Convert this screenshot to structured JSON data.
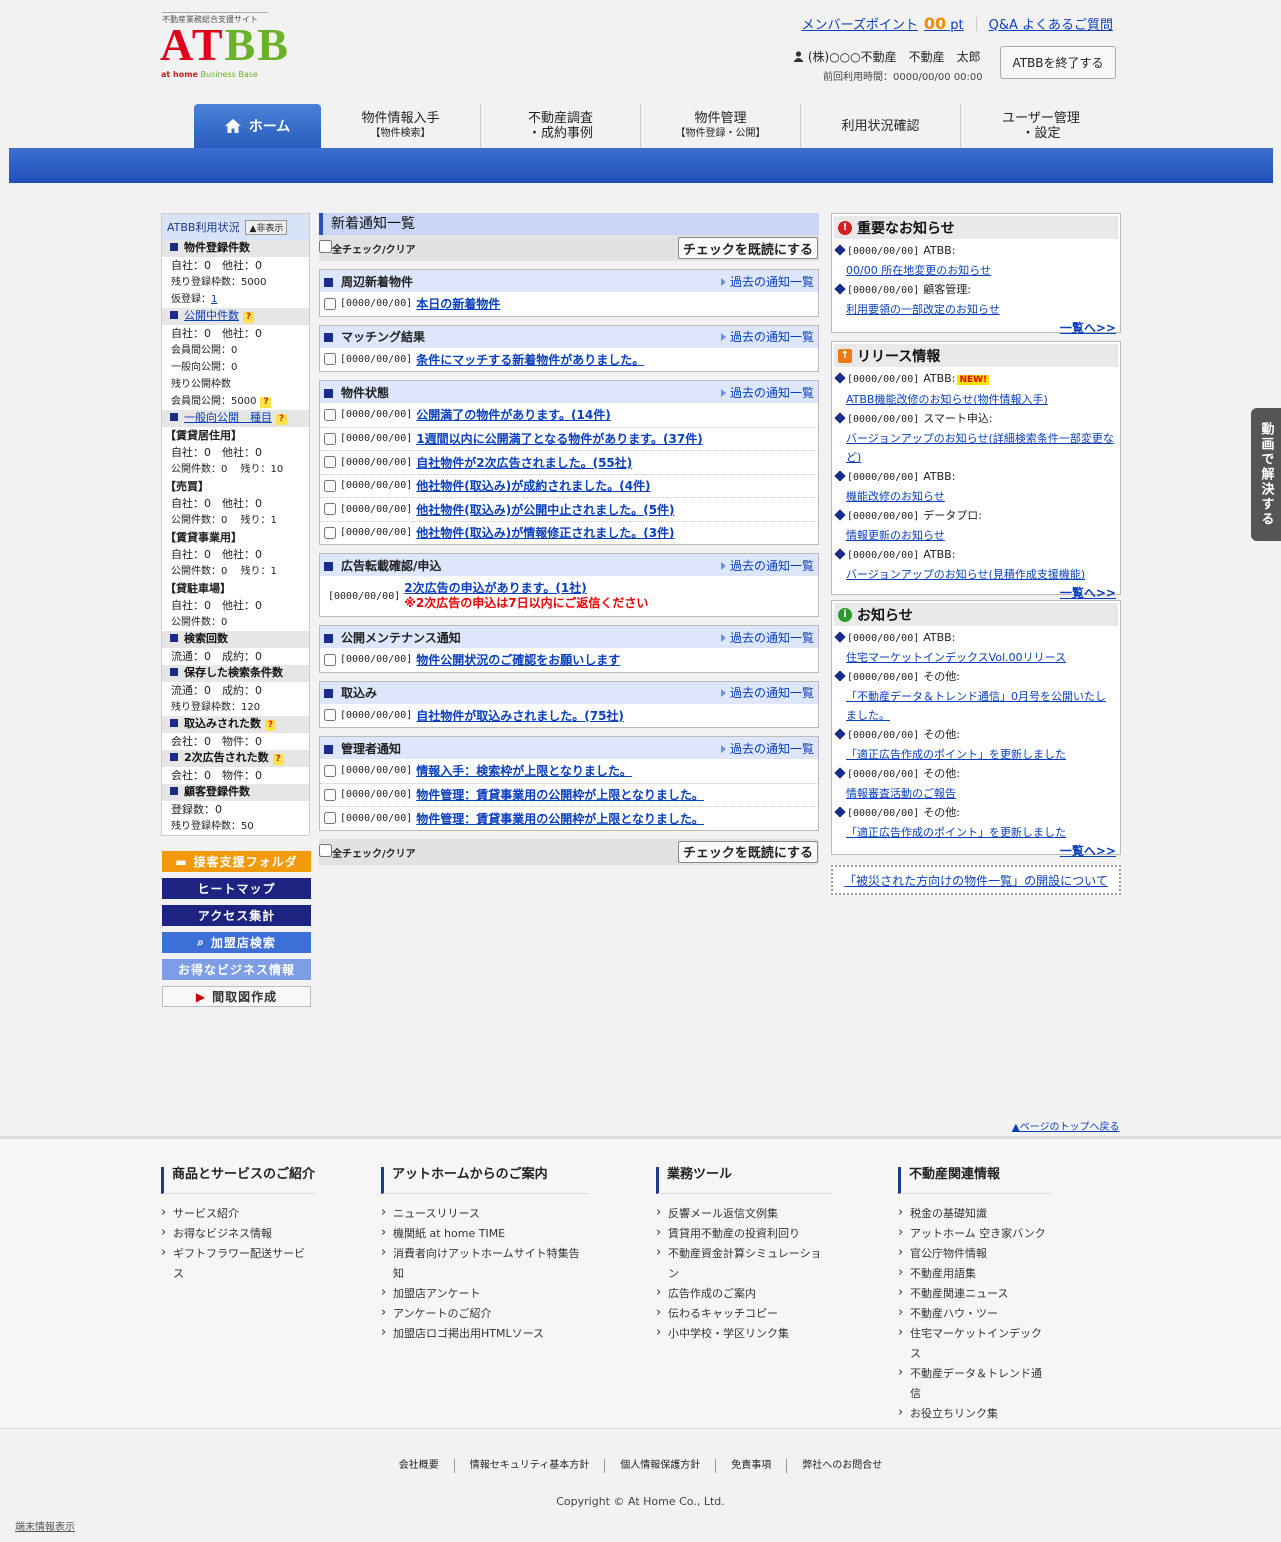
{
  "header": {
    "logo_tagline": "不動産業務総合支援サイト",
    "logo_letters": [
      "A",
      "T",
      "B",
      "B"
    ],
    "logo_sub_1": "at home",
    "logo_sub_2": "Business Base",
    "member_points_label": "メンバーズポイント",
    "member_points_value": "00",
    "member_points_unit": "pt",
    "qa_link": "Q&A よくあるご質問",
    "user_name": "(株)○○○不動産　不動産　太郎",
    "last_login": "前回利用時間：0000/00/00 00:00",
    "end_button": "ATBBを終了する"
  },
  "nav": {
    "home": "ホーム",
    "tabs": [
      {
        "line1": "物件情報入手",
        "line2": "【物件検索】"
      },
      {
        "line1": "不動産調査",
        "line2": "・成約事例"
      },
      {
        "line1": "物件管理",
        "line2": "【物件登録・公開】"
      },
      {
        "line1": "利用状況確認",
        "line2": ""
      },
      {
        "line1": "ユーザー管理",
        "line2": "・設定"
      }
    ]
  },
  "sidebar": {
    "title": "ATBB利用状況",
    "hide_button": "▲非表示",
    "rows": [
      {
        "type": "hd",
        "text": "物件登録件数"
      },
      {
        "type": "r",
        "text": "自社：0　他社：0"
      },
      {
        "type": "s",
        "text": "残り登録枠数：5000"
      },
      {
        "type": "s",
        "text": "仮登録：",
        "link": "1"
      },
      {
        "type": "hd",
        "text": "公開中件数",
        "link": true,
        "q": true
      },
      {
        "type": "r",
        "text": "自社：0　他社：0"
      },
      {
        "type": "s",
        "text": "会員間公開：0"
      },
      {
        "type": "s",
        "text": "一般向公開：0"
      },
      {
        "type": "s",
        "text": "残り公開枠数"
      },
      {
        "type": "s",
        "text": "会員間公開：5000",
        "q": true
      },
      {
        "type": "hd",
        "text": "一般向公開　種目",
        "link": true,
        "q": true
      },
      {
        "type": "g",
        "text": "【賃貸居住用】"
      },
      {
        "type": "r",
        "text": "自社：0　他社：0"
      },
      {
        "type": "s",
        "text": "公開件数：0　 残り：10"
      },
      {
        "type": "g",
        "text": "【売買】"
      },
      {
        "type": "r",
        "text": "自社：0　他社：0"
      },
      {
        "type": "s",
        "text": "公開件数：0　 残り：1"
      },
      {
        "type": "g",
        "text": "【賃貸事業用】"
      },
      {
        "type": "r",
        "text": "自社：0　他社：0"
      },
      {
        "type": "s",
        "text": "公開件数：0　 残り：1"
      },
      {
        "type": "g",
        "text": "【貸駐車場】"
      },
      {
        "type": "r",
        "text": "自社：0　他社：0"
      },
      {
        "type": "s",
        "text": "公開件数：0"
      },
      {
        "type": "hd",
        "text": "検索回数"
      },
      {
        "type": "r",
        "text": "流通：0　成約：0"
      },
      {
        "type": "hd",
        "text": "保存した検索条件数"
      },
      {
        "type": "r",
        "text": "流通：0　成約：0"
      },
      {
        "type": "s",
        "text": "残り登録枠数：120"
      },
      {
        "type": "hd",
        "text": "取込みされた数",
        "q": true
      },
      {
        "type": "r",
        "text": "会社：0　物件：0"
      },
      {
        "type": "hd",
        "text": "2次広告された数",
        "q": true
      },
      {
        "type": "r",
        "text": "会社：0　物件：0"
      },
      {
        "type": "hd",
        "text": "顧客登録件数"
      },
      {
        "type": "r",
        "text": "登録数：0"
      },
      {
        "type": "s",
        "text": "残り登録枠数：50"
      }
    ],
    "buttons": [
      {
        "label": "接客支援フォルダ",
        "color": "#f39a0c",
        "icon": "folder-icon"
      },
      {
        "label": "ヒートマップ",
        "color": "#1c2380"
      },
      {
        "label": "アクセス集計",
        "color": "#1c2380"
      },
      {
        "label": "加盟店検索",
        "color": "#3d6fd8",
        "icon": "shop-search-icon"
      },
      {
        "label": "お得なビジネス情報",
        "color": "#7d9ee6"
      },
      {
        "label": "間取図作成",
        "color": "#f8f8f8",
        "icon": "play-icon"
      }
    ]
  },
  "center": {
    "title": "新着通知一覧",
    "check_all": "全チェック/クリア",
    "mark_read": "チェックを既読にする",
    "past_label": "過去の通知一覧",
    "sections": [
      {
        "title": "周辺新着物件",
        "items": [
          {
            "date": "[0000/00/00]",
            "text": "本日の新着物件"
          }
        ]
      },
      {
        "title": "マッチング結果",
        "items": [
          {
            "date": "[0000/00/00]",
            "text": "条件にマッチする新着物件がありました。"
          }
        ]
      },
      {
        "title": "物件状態",
        "items": [
          {
            "date": "[0000/00/00]",
            "text": "公開満了の物件があります。(14件)"
          },
          {
            "date": "[0000/00/00]",
            "text": "1週間以内に公開満了となる物件があります。(37件)"
          },
          {
            "date": "[0000/00/00]",
            "text": "自社物件が2次広告されました。(55社)"
          },
          {
            "date": "[0000/00/00]",
            "text": "他社物件(取込み)が成約されました。(4件)"
          },
          {
            "date": "[0000/00/00]",
            "text": "他社物件(取込み)が公開中止されました。(5件)"
          },
          {
            "date": "[0000/00/00]",
            "text": "他社物件(取込み)が情報修正されました。(3件)"
          }
        ]
      },
      {
        "title": "広告転載確認/申込",
        "special": true,
        "items": [
          {
            "date": "[0000/00/00]",
            "text": "2次広告の申込があります。(1社)",
            "note": "※2次広告の申込は7日以内にご返信ください"
          }
        ]
      },
      {
        "title": "公開メンテナンス通知",
        "items": [
          {
            "date": "[0000/00/00]",
            "text": "物件公開状況のご確認をお願いします"
          }
        ]
      },
      {
        "title": "取込み",
        "items": [
          {
            "date": "[0000/00/00]",
            "text": "自社物件が取込みされました。(75社)"
          }
        ]
      },
      {
        "title": "管理者通知",
        "items": [
          {
            "date": "[0000/00/00]",
            "text": "情報入手：検索枠が上限となりました。"
          },
          {
            "date": "[0000/00/00]",
            "text": "物件管理：賃貸事業用の公開枠が上限となりました。"
          },
          {
            "date": "[0000/00/00]",
            "text": "物件管理：賃貸事業用の公開枠が上限となりました。"
          }
        ]
      }
    ]
  },
  "right": {
    "important": {
      "title": "重要なお知らせ",
      "items": [
        {
          "date": "[0000/00/00]",
          "src": "ATBB:",
          "link": "00/00 所在地変更のお知らせ"
        },
        {
          "date": "[0000/00/00]",
          "src": "顧客管理:",
          "link": "利用要領の一部改定のお知らせ"
        }
      ],
      "more": "一覧へ>>"
    },
    "release": {
      "title": "リリース情報",
      "new_badge": "NEW!",
      "items": [
        {
          "date": "[0000/00/00]",
          "src": "ATBB:",
          "link": "ATBB機能改修のお知らせ(物件情報入手)",
          "new": true
        },
        {
          "date": "[0000/00/00]",
          "src": "スマート申込:",
          "link": "バージョンアップのお知らせ(詳細検索条件一部変更など)"
        },
        {
          "date": "[0000/00/00]",
          "src": "ATBB:",
          "link": "機能改修のお知らせ"
        },
        {
          "date": "[0000/00/00]",
          "src": "データプロ:",
          "link": "情報更新のお知らせ"
        },
        {
          "date": "[0000/00/00]",
          "src": "ATBB:",
          "link": "バージョンアップのお知らせ(見積作成支援機能)"
        }
      ],
      "more": "一覧へ>>"
    },
    "news": {
      "title": "お知らせ",
      "items": [
        {
          "date": "[0000/00/00]",
          "src": "ATBB:",
          "link": "住宅マーケットインデックスVol.00リリース"
        },
        {
          "date": "[0000/00/00]",
          "src": "その他:",
          "link": "「不動産データ＆トレンド通信」0月号を公開いたしました。"
        },
        {
          "date": "[0000/00/00]",
          "src": "その他:",
          "link": "「適正広告作成のポイント」を更新しました"
        },
        {
          "date": "[0000/00/00]",
          "src": "その他:",
          "link": "情報審査活動のご報告"
        },
        {
          "date": "[0000/00/00]",
          "src": "その他:",
          "link": "「適正広告作成のポイント」を更新しました"
        }
      ],
      "more": "一覧へ>>"
    },
    "disaster_link": "「被災された方向けの物件一覧」の開設について"
  },
  "video_tab": "動画で解決する",
  "page_top": "▲ページのトップへ戻る",
  "footer": {
    "cols": [
      {
        "title": "商品とサービスのご紹介",
        "items": [
          "サービス紹介",
          "お得なビジネス情報",
          "ギフトフラワー配送サービス"
        ]
      },
      {
        "title": "アットホームからのご案内",
        "items": [
          "ニュースリリース",
          "機関紙 at home TIME",
          "消費者向けアットホームサイト特集告知",
          "加盟店アンケート",
          "アンケートのご紹介",
          "加盟店ロゴ掲出用HTMLソース"
        ]
      },
      {
        "title": "業務ツール",
        "items": [
          "反響メール返信文例集",
          "賃貸用不動産の投資利回り",
          "不動産資金計算シミュレーション",
          "広告作成のご案内",
          "伝わるキャッチコピー",
          "小中学校・学区リンク集"
        ]
      },
      {
        "title": "不動産関連情報",
        "items": [
          "税金の基礎知識",
          "アットホーム 空き家バンク",
          "官公庁物件情報",
          "不動産用語集",
          "不動産関連ニュース",
          "不動産ハウ・ツー",
          "住宅マーケットインデックス",
          "不動産データ＆トレンド通信",
          "お役立ちリンク集"
        ]
      }
    ],
    "bottom_links": [
      "会社概要",
      "情報セキュリティ基本方針",
      "個人情報保護方針",
      "免責事項",
      "弊社へのお問合せ"
    ],
    "copyright": "Copyright © At Home Co., Ltd.",
    "terminal_info": "端末情報表示"
  }
}
